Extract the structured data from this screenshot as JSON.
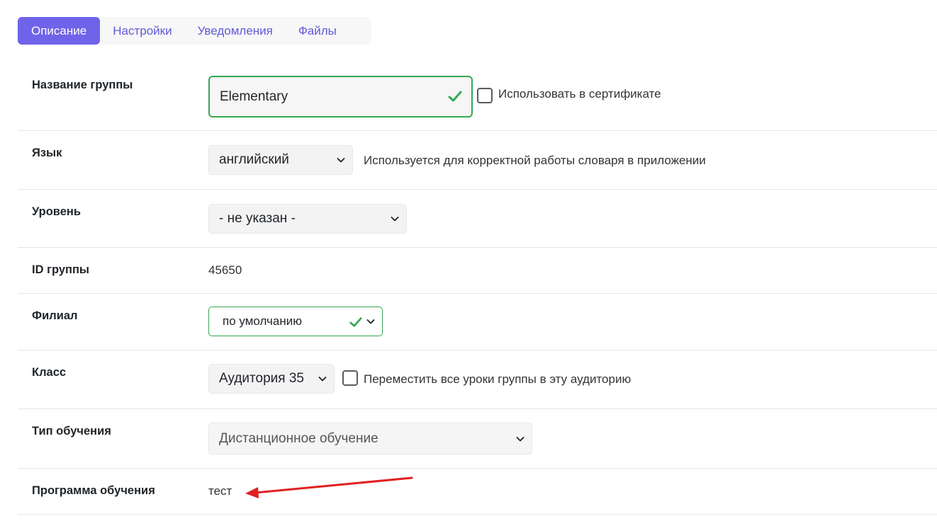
{
  "tabs": [
    {
      "label": "Описание",
      "active": true
    },
    {
      "label": "Настройки",
      "active": false
    },
    {
      "label": "Уведомления",
      "active": false
    },
    {
      "label": "Файлы",
      "active": false
    }
  ],
  "colors": {
    "accent": "#6f63e9",
    "tab_text": "#6259d6",
    "success": "#34a853",
    "annotation_arrow": "#e02020"
  },
  "form": {
    "group_name": {
      "label": "Название группы",
      "value": "Elementary",
      "checkbox_label": "Использовать в сертификате",
      "checkbox_checked": false
    },
    "language": {
      "label": "Язык",
      "selected": "английский",
      "hint": "Используется для корректной работы словаря в приложении"
    },
    "level": {
      "label": "Уровень",
      "selected": "- не указан -"
    },
    "group_id": {
      "label": "ID группы",
      "value": "45650"
    },
    "branch": {
      "label": "Филиал",
      "selected": "по умолчанию"
    },
    "classroom": {
      "label": "Класс",
      "selected": "Аудитория 35",
      "checkbox_label": "Переместить все уроки группы в эту аудиторию",
      "checkbox_checked": false
    },
    "study_type": {
      "label": "Тип обучения",
      "selected": "Дистанционное обучение"
    },
    "program": {
      "label": "Программа обучения",
      "value": "тест"
    }
  }
}
